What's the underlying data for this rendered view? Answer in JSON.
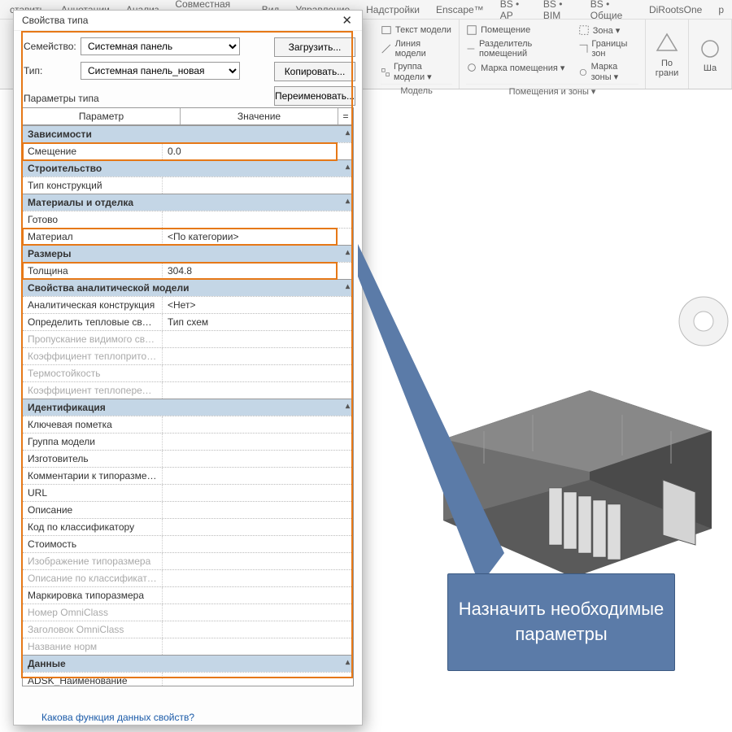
{
  "ribbon": {
    "tabs": [
      "ставить",
      "Аннотации",
      "Анализ",
      "Совместная работа",
      "Вид",
      "Управление",
      "Надстройки",
      "Enscape™",
      "BS • AP",
      "BS • BIM",
      "BS • Общие",
      "DiRootsOne",
      "p"
    ],
    "model_group": {
      "lines": [
        "Текст модели",
        "Линия  модели",
        "Группа модели  ▾"
      ],
      "title": "Модель"
    },
    "rooms_group": {
      "lines": [
        "Помещение",
        "Разделитель помещений",
        "Марка помещения  ▾"
      ],
      "zones": [
        "Зона  ▾",
        "Границы  зон",
        "Марка  зоны  ▾"
      ],
      "title": "Помещения и зоны  ▾"
    },
    "face_group": {
      "title": "По\nграни",
      "extra": "Ша"
    }
  },
  "dialog": {
    "title": "Свойства типа",
    "family_label": "Семейство:",
    "family_value": "Системная панель",
    "type_label": "Тип:",
    "type_value": "Системная панель_новая",
    "btn_load": "Загрузить...",
    "btn_copy": "Копировать...",
    "btn_rename": "Переименовать...",
    "params_label": "Параметры типа",
    "head_param": "Параметр",
    "head_value": "Значение",
    "head_eq": "=",
    "sections": [
      {
        "title": "Зависимости",
        "rows": [
          {
            "n": "Смещение",
            "v": "0.0",
            "hl": "offset"
          }
        ]
      },
      {
        "title": "Строительство",
        "rows": [
          {
            "n": "Тип конструкций",
            "v": ""
          }
        ]
      },
      {
        "title": "Материалы и отделка",
        "rows": [
          {
            "n": "Готово",
            "v": ""
          },
          {
            "n": "Материал",
            "v": "<По категории>",
            "hl": "material"
          }
        ]
      },
      {
        "title": "Размеры",
        "rows": [
          {
            "n": "Толщина",
            "v": "304.8",
            "hl": "thick"
          }
        ]
      },
      {
        "title": "Свойства аналитической модели",
        "rows": [
          {
            "n": "Аналитическая конструкция",
            "v": "<Нет>"
          },
          {
            "n": "Определить тепловые свойства",
            "v": "Тип схем"
          },
          {
            "n": "Пропускание видимого света",
            "v": "",
            "dim": true
          },
          {
            "n": "Коэффициент теплопритока от",
            "v": "",
            "dim": true
          },
          {
            "n": "Термостойкость",
            "v": "",
            "dim": true
          },
          {
            "n": "Коэффициент теплопередачи (",
            "v": "",
            "dim": true
          }
        ]
      },
      {
        "title": "Идентификация",
        "rows": [
          {
            "n": "Ключевая пометка",
            "v": ""
          },
          {
            "n": "Группа модели",
            "v": ""
          },
          {
            "n": "Изготовитель",
            "v": ""
          },
          {
            "n": "Комментарии к типоразмеру",
            "v": ""
          },
          {
            "n": "URL",
            "v": ""
          },
          {
            "n": "Описание",
            "v": ""
          },
          {
            "n": "Код по классификатору",
            "v": ""
          },
          {
            "n": "Стоимость",
            "v": ""
          },
          {
            "n": "Изображение типоразмера",
            "v": "",
            "dim": true
          },
          {
            "n": "Описание по классификатору",
            "v": "",
            "dim": true
          },
          {
            "n": "Маркировка типоразмера",
            "v": ""
          },
          {
            "n": "Номер OmniClass",
            "v": "",
            "dim": true
          },
          {
            "n": "Заголовок OmniClass",
            "v": "",
            "dim": true
          },
          {
            "n": "Название норм",
            "v": "",
            "dim": true
          }
        ]
      },
      {
        "title": "Данные",
        "rows": [
          {
            "n": "ADSK_Наименование",
            "v": ""
          }
        ]
      }
    ],
    "footer_link": "Какова функция данных свойств?"
  },
  "callout": "Назначить необходимые параметры"
}
